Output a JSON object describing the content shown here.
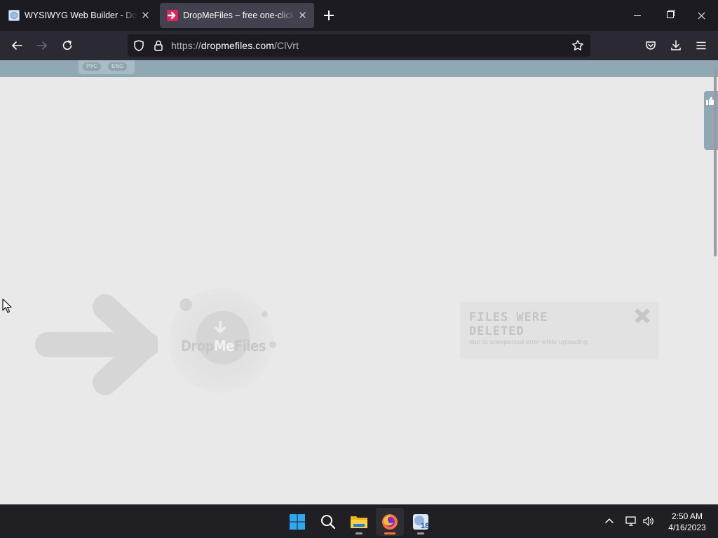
{
  "browser": {
    "tabs": [
      {
        "title": "WYSIWYG Web Builder - Downl",
        "favicon": "wysiwyg-favicon",
        "active": false
      },
      {
        "title": "DropMeFiles – free one-click file",
        "favicon": "dropmefiles-arrow-favicon",
        "active": true
      }
    ],
    "url_scheme": "https://",
    "url_host": "dropmefiles.com",
    "url_path": "/ClVrt"
  },
  "page": {
    "lang_ru": "РУС",
    "lang_en": "ENG",
    "logo_pre": "Drop",
    "logo_me": "Me",
    "logo_post": "Files",
    "message_title": "FILES WERE DELETED",
    "message_subtitle": "due to unexpected error while uploading"
  },
  "taskbar": {
    "apps": [
      "windows-start-icon",
      "search-icon",
      "file-explorer-icon",
      "firefox-icon",
      "app-18-icon"
    ],
    "badge": "18",
    "time": "2:50 AM",
    "date": "4/16/2023"
  },
  "colors": {
    "accent_header": "#8fa8b4",
    "page_bg": "#e9e9e9",
    "firefox_active_indicator": "#ff7139"
  }
}
